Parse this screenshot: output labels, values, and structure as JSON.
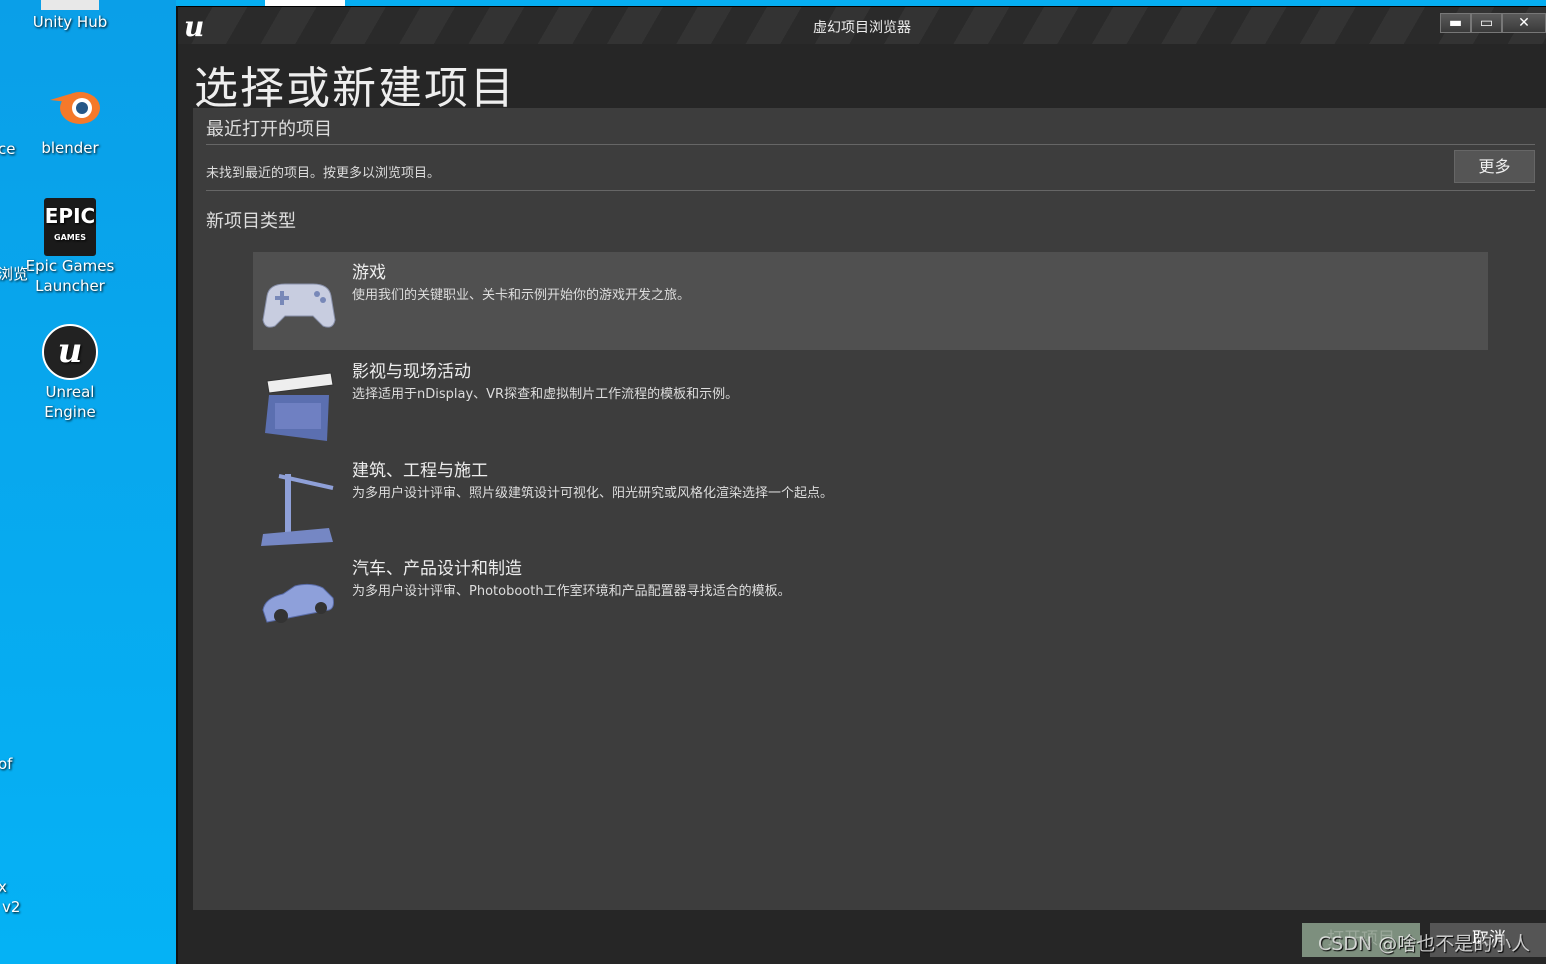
{
  "desktop": {
    "icons": [
      {
        "label": "Unity Hub",
        "icon": "unity-hub-icon"
      },
      {
        "label": "blender",
        "icon": "blender-icon"
      },
      {
        "label": "Epic Games Launcher",
        "icon": "epic-games-icon"
      },
      {
        "label": "Unreal Engine",
        "icon": "unreal-engine-icon"
      }
    ],
    "clipped_labels": [
      "ce",
      "浏览",
      "of",
      "x",
      "v2"
    ],
    "background": "#06aef2"
  },
  "window": {
    "title": "虚幻项目浏览器",
    "controls": {
      "minimize": "▬",
      "maximize": "▭",
      "close": "✕"
    },
    "heading": "选择或新建项目",
    "recent": {
      "title": "最近打开的项目",
      "empty_text": "未找到最近的项目。按更多以浏览项目。",
      "more_label": "更多"
    },
    "new_types": {
      "title": "新项目类型",
      "items": [
        {
          "title": "游戏",
          "desc": "使用我们的关键职业、关卡和示例开始你的游戏开发之旅。",
          "icon": "gamepad-icon",
          "selected": true
        },
        {
          "title": "影视与现场活动",
          "desc": "选择适用于nDisplay、VR探查和虚拟制片工作流程的模板和示例。",
          "icon": "clapperboard-icon",
          "selected": false
        },
        {
          "title": "建筑、工程与施工",
          "desc": "为多用户设计评审、照片级建筑设计可视化、阳光研究或风格化渲染选择一个起点。",
          "icon": "crane-icon",
          "selected": false
        },
        {
          "title": "汽车、产品设计和制造",
          "desc": "为多用户设计评审、Photobooth工作室环境和产品配置器寻找适合的模板。",
          "icon": "car-icon",
          "selected": false
        }
      ]
    },
    "buttons": {
      "open": "打开项目",
      "cancel": "取消"
    }
  },
  "watermark": "CSDN @啥也不是的小人"
}
